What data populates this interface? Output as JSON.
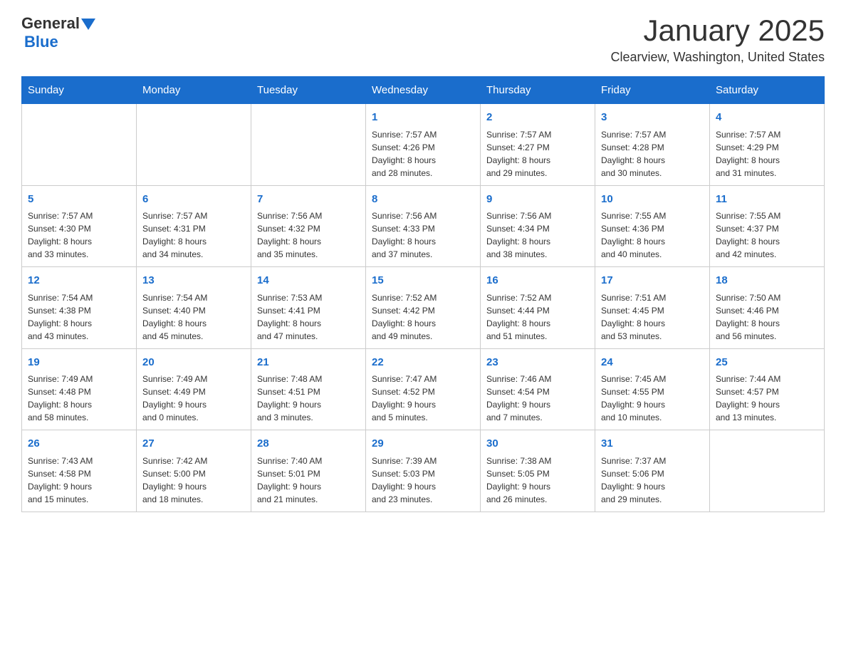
{
  "header": {
    "logo_general": "General",
    "logo_blue": "Blue",
    "title": "January 2025",
    "subtitle": "Clearview, Washington, United States"
  },
  "days_of_week": [
    "Sunday",
    "Monday",
    "Tuesday",
    "Wednesday",
    "Thursday",
    "Friday",
    "Saturday"
  ],
  "weeks": [
    [
      {
        "day": "",
        "info": ""
      },
      {
        "day": "",
        "info": ""
      },
      {
        "day": "",
        "info": ""
      },
      {
        "day": "1",
        "info": "Sunrise: 7:57 AM\nSunset: 4:26 PM\nDaylight: 8 hours\nand 28 minutes."
      },
      {
        "day": "2",
        "info": "Sunrise: 7:57 AM\nSunset: 4:27 PM\nDaylight: 8 hours\nand 29 minutes."
      },
      {
        "day": "3",
        "info": "Sunrise: 7:57 AM\nSunset: 4:28 PM\nDaylight: 8 hours\nand 30 minutes."
      },
      {
        "day": "4",
        "info": "Sunrise: 7:57 AM\nSunset: 4:29 PM\nDaylight: 8 hours\nand 31 minutes."
      }
    ],
    [
      {
        "day": "5",
        "info": "Sunrise: 7:57 AM\nSunset: 4:30 PM\nDaylight: 8 hours\nand 33 minutes."
      },
      {
        "day": "6",
        "info": "Sunrise: 7:57 AM\nSunset: 4:31 PM\nDaylight: 8 hours\nand 34 minutes."
      },
      {
        "day": "7",
        "info": "Sunrise: 7:56 AM\nSunset: 4:32 PM\nDaylight: 8 hours\nand 35 minutes."
      },
      {
        "day": "8",
        "info": "Sunrise: 7:56 AM\nSunset: 4:33 PM\nDaylight: 8 hours\nand 37 minutes."
      },
      {
        "day": "9",
        "info": "Sunrise: 7:56 AM\nSunset: 4:34 PM\nDaylight: 8 hours\nand 38 minutes."
      },
      {
        "day": "10",
        "info": "Sunrise: 7:55 AM\nSunset: 4:36 PM\nDaylight: 8 hours\nand 40 minutes."
      },
      {
        "day": "11",
        "info": "Sunrise: 7:55 AM\nSunset: 4:37 PM\nDaylight: 8 hours\nand 42 minutes."
      }
    ],
    [
      {
        "day": "12",
        "info": "Sunrise: 7:54 AM\nSunset: 4:38 PM\nDaylight: 8 hours\nand 43 minutes."
      },
      {
        "day": "13",
        "info": "Sunrise: 7:54 AM\nSunset: 4:40 PM\nDaylight: 8 hours\nand 45 minutes."
      },
      {
        "day": "14",
        "info": "Sunrise: 7:53 AM\nSunset: 4:41 PM\nDaylight: 8 hours\nand 47 minutes."
      },
      {
        "day": "15",
        "info": "Sunrise: 7:52 AM\nSunset: 4:42 PM\nDaylight: 8 hours\nand 49 minutes."
      },
      {
        "day": "16",
        "info": "Sunrise: 7:52 AM\nSunset: 4:44 PM\nDaylight: 8 hours\nand 51 minutes."
      },
      {
        "day": "17",
        "info": "Sunrise: 7:51 AM\nSunset: 4:45 PM\nDaylight: 8 hours\nand 53 minutes."
      },
      {
        "day": "18",
        "info": "Sunrise: 7:50 AM\nSunset: 4:46 PM\nDaylight: 8 hours\nand 56 minutes."
      }
    ],
    [
      {
        "day": "19",
        "info": "Sunrise: 7:49 AM\nSunset: 4:48 PM\nDaylight: 8 hours\nand 58 minutes."
      },
      {
        "day": "20",
        "info": "Sunrise: 7:49 AM\nSunset: 4:49 PM\nDaylight: 9 hours\nand 0 minutes."
      },
      {
        "day": "21",
        "info": "Sunrise: 7:48 AM\nSunset: 4:51 PM\nDaylight: 9 hours\nand 3 minutes."
      },
      {
        "day": "22",
        "info": "Sunrise: 7:47 AM\nSunset: 4:52 PM\nDaylight: 9 hours\nand 5 minutes."
      },
      {
        "day": "23",
        "info": "Sunrise: 7:46 AM\nSunset: 4:54 PM\nDaylight: 9 hours\nand 7 minutes."
      },
      {
        "day": "24",
        "info": "Sunrise: 7:45 AM\nSunset: 4:55 PM\nDaylight: 9 hours\nand 10 minutes."
      },
      {
        "day": "25",
        "info": "Sunrise: 7:44 AM\nSunset: 4:57 PM\nDaylight: 9 hours\nand 13 minutes."
      }
    ],
    [
      {
        "day": "26",
        "info": "Sunrise: 7:43 AM\nSunset: 4:58 PM\nDaylight: 9 hours\nand 15 minutes."
      },
      {
        "day": "27",
        "info": "Sunrise: 7:42 AM\nSunset: 5:00 PM\nDaylight: 9 hours\nand 18 minutes."
      },
      {
        "day": "28",
        "info": "Sunrise: 7:40 AM\nSunset: 5:01 PM\nDaylight: 9 hours\nand 21 minutes."
      },
      {
        "day": "29",
        "info": "Sunrise: 7:39 AM\nSunset: 5:03 PM\nDaylight: 9 hours\nand 23 minutes."
      },
      {
        "day": "30",
        "info": "Sunrise: 7:38 AM\nSunset: 5:05 PM\nDaylight: 9 hours\nand 26 minutes."
      },
      {
        "day": "31",
        "info": "Sunrise: 7:37 AM\nSunset: 5:06 PM\nDaylight: 9 hours\nand 29 minutes."
      },
      {
        "day": "",
        "info": ""
      }
    ]
  ]
}
